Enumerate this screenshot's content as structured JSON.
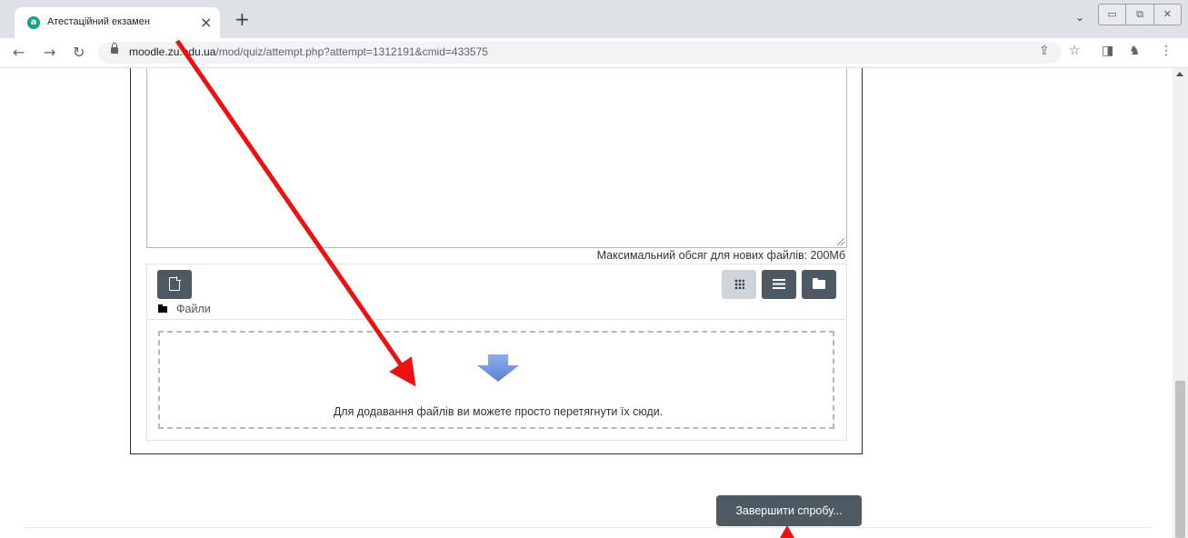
{
  "browser": {
    "tab_title": "Атестаційний екзамен",
    "tab_close": "×",
    "new_tab": "+",
    "url_host": "moodle.zu.edu.ua",
    "url_path": "/mod/quiz/attempt.php?attempt=1312191&cmid=433575"
  },
  "file_manager": {
    "max_size_text": "Максимальний обсяг для нових файлів: 200Мб",
    "path_label": "Файли",
    "drop_text": "Для додавання файлів ви можете просто перетягнути їх сюди."
  },
  "quiz": {
    "finish_button": "Завершити спробу..."
  },
  "colors": {
    "button_dark": "#4d5a63",
    "annotation_arrow": "#ee1111",
    "drop_arrow": "#6b8fd6"
  }
}
